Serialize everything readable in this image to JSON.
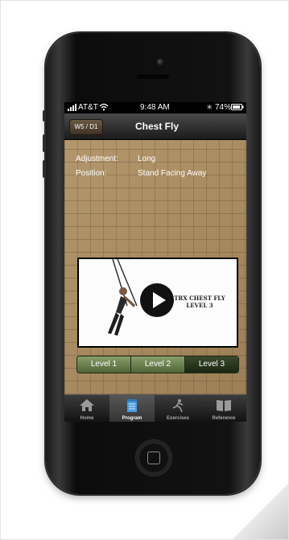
{
  "status_bar": {
    "carrier": "AT&T",
    "time": "9:48 AM",
    "battery": "74%"
  },
  "nav": {
    "back_label": "W5 / D1",
    "title": "Chest Fly"
  },
  "exercise": {
    "adjustment_label": "Adjustment:",
    "adjustment_value": "Long",
    "position_label": "Position:",
    "position_value": "Stand Facing Away"
  },
  "video": {
    "overlay_line1": "TRX CHEST FLY",
    "overlay_line2": "LEVEL 3"
  },
  "levels": {
    "items": [
      "Level 1",
      "Level 2",
      "Level 3"
    ],
    "selected": "Level 3"
  },
  "tabs": {
    "home": "Home",
    "program": "Program",
    "exercises": "Exercises",
    "reference": "Reference",
    "active": "Program"
  }
}
